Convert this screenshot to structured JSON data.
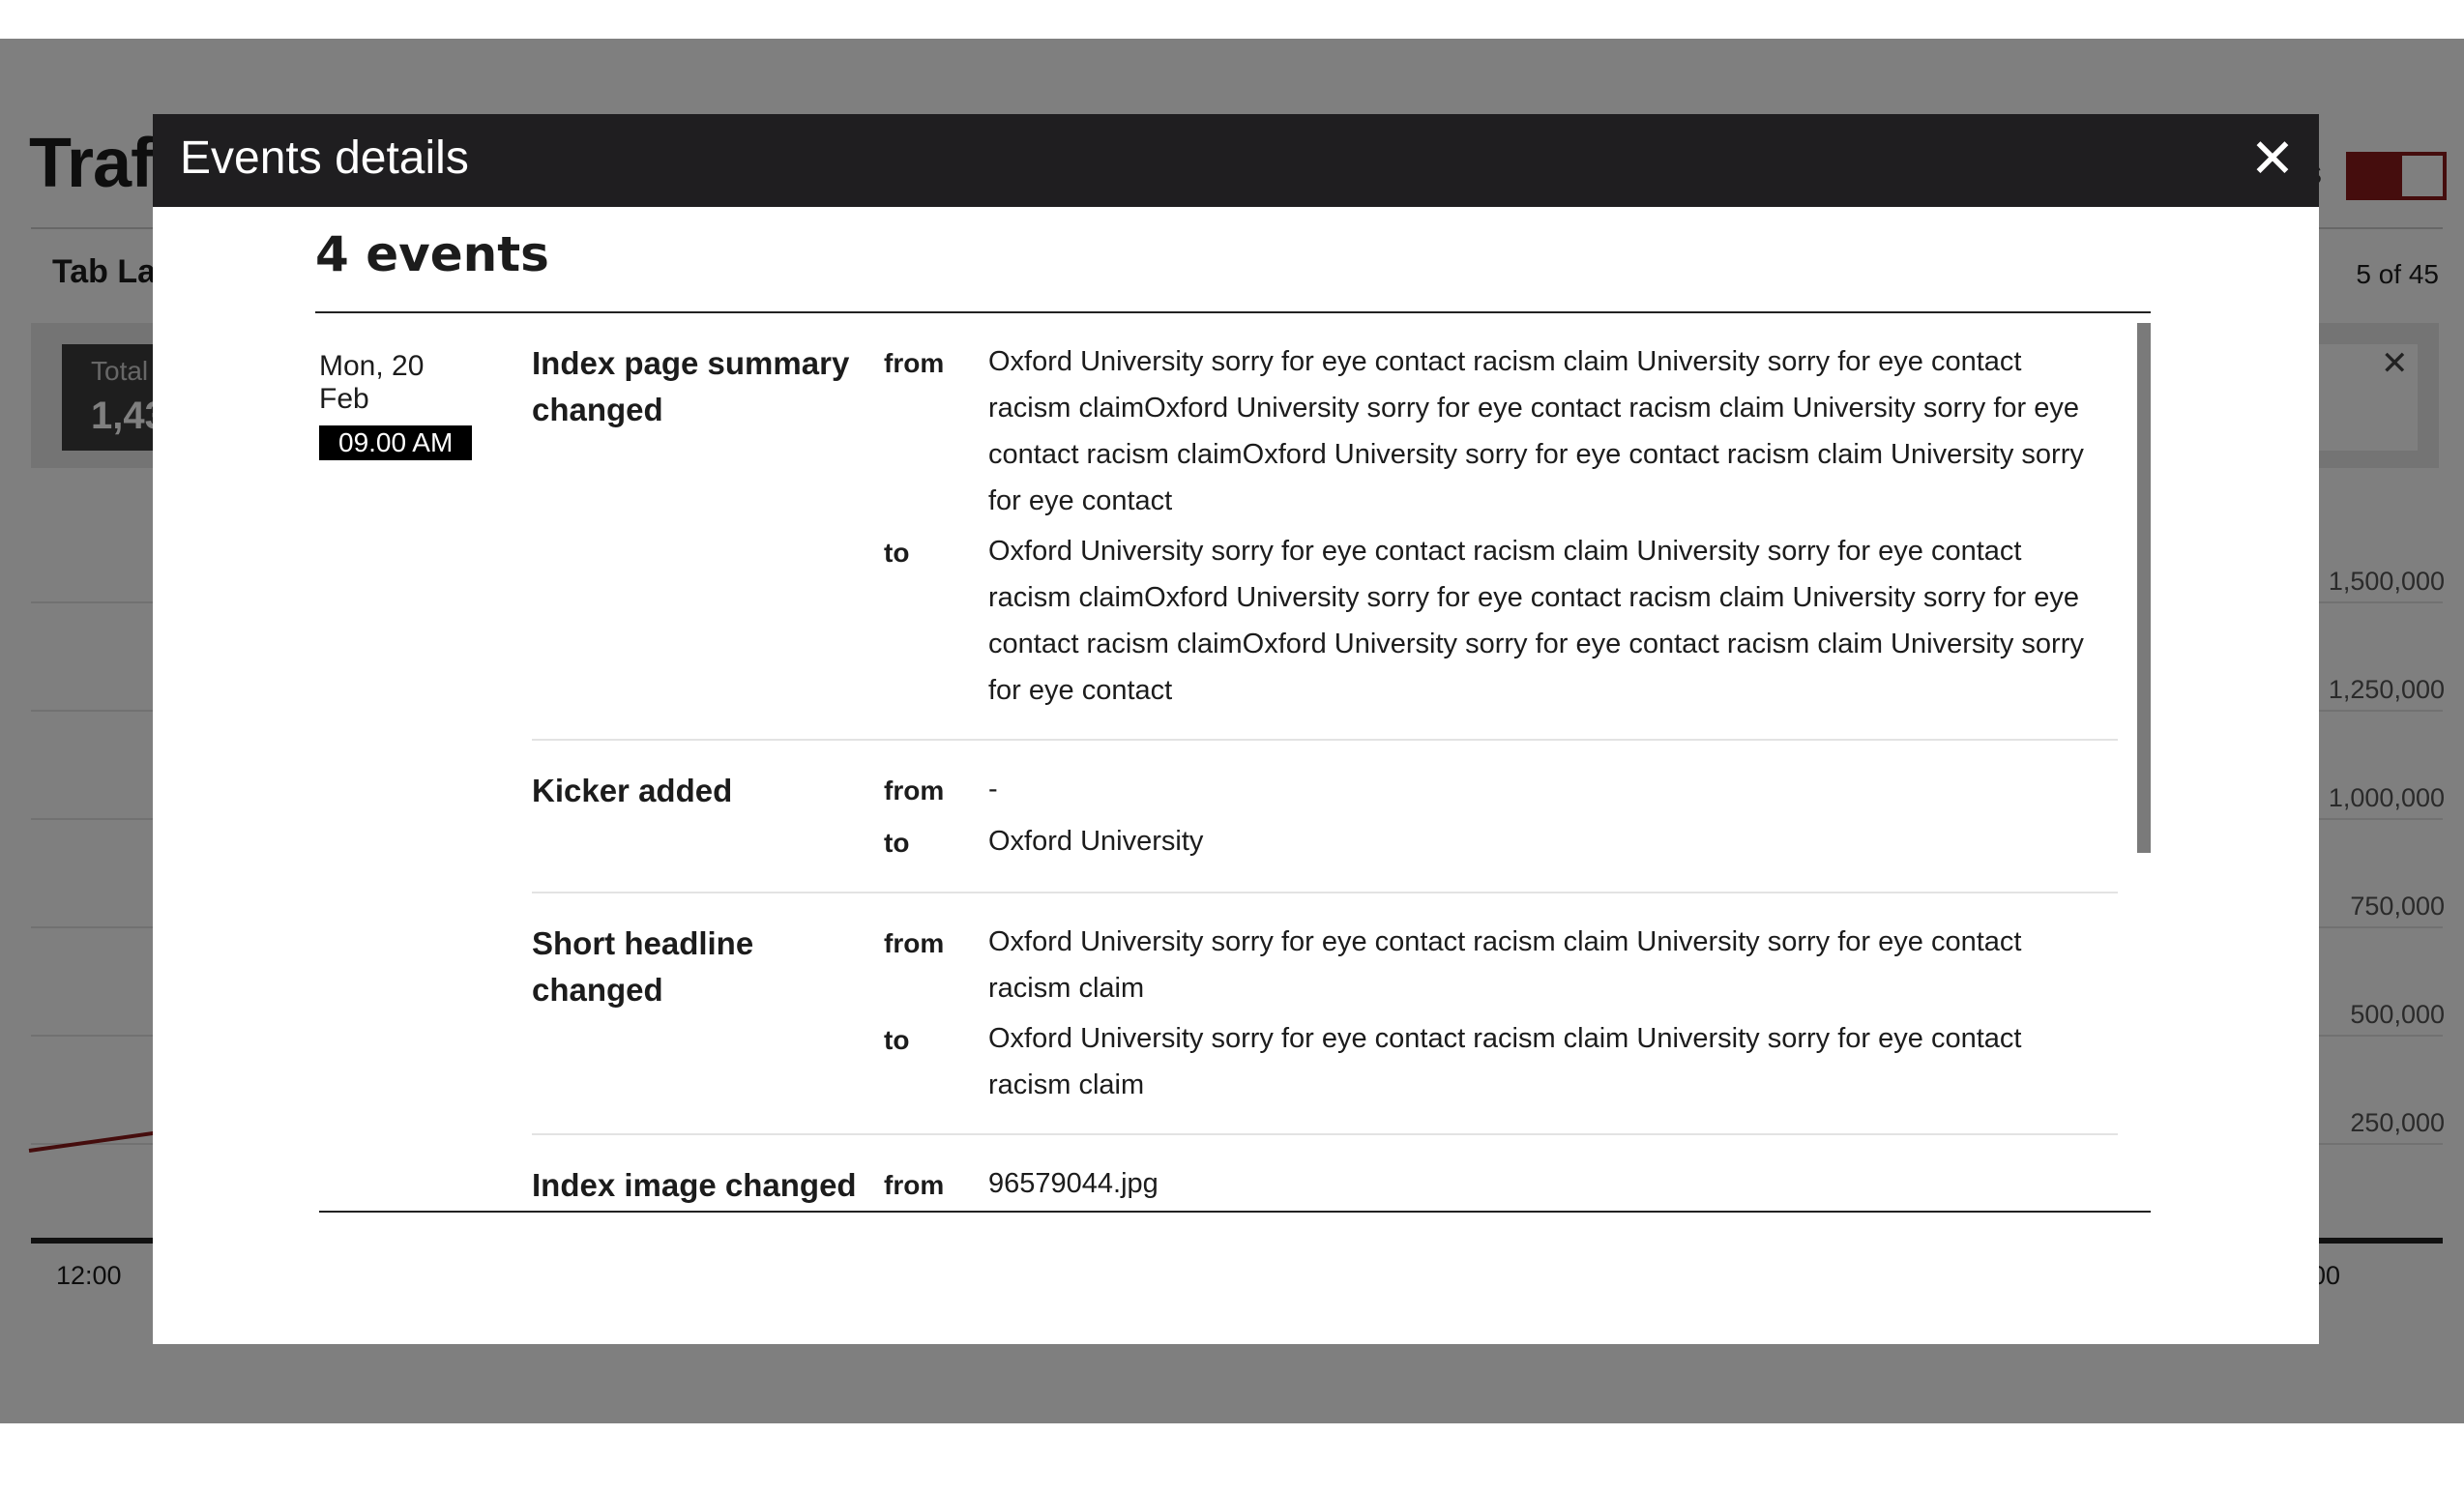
{
  "background": {
    "title": "Traff",
    "tab_label": "Tab Lal",
    "counter": "5 of 45",
    "toggle_text": "s",
    "total_label": "Total",
    "total_value": "1,43",
    "y_ticks": [
      "1,500,000",
      "1,250,000",
      "1,000,000",
      "750,000",
      "500,000",
      "250,000"
    ],
    "x_tick_left": "12:00",
    "x_tick_right": "00",
    "close_icon": "close-icon",
    "series_color": "#8b1a1a"
  },
  "modal": {
    "title": "Events details",
    "close_glyph": "✕",
    "count": "4 events",
    "date": "Mon, 20 Feb",
    "time": "09.00 AM",
    "events": [
      {
        "name": "Index page summary changed",
        "from_label": "from",
        "from": "Oxford University sorry for eye contact racism claim University sorry for eye contact racism claimOxford University sorry for eye contact racism claim University sorry for eye contact racism claimOxford University sorry for eye contact racism claim University sorry for eye contact",
        "to_label": "to",
        "to": "Oxford University sorry for eye contact racism claim University sorry for eye contact racism claimOxford University sorry for eye contact racism claim University sorry for eye contact racism claimOxford University sorry for eye contact racism claim University sorry for eye contact"
      },
      {
        "name": "Kicker added",
        "from_label": "from",
        "from": "-",
        "to_label": "to",
        "to": "Oxford University"
      },
      {
        "name": "Short headline changed",
        "from_label": "from",
        "from": "Oxford University sorry for eye contact racism claim University sorry for eye contact racism claim",
        "to_label": "to",
        "to": "Oxford University sorry for eye contact racism claim University sorry for eye contact racism claim"
      },
      {
        "name": "Index image changed",
        "from_label": "from",
        "from": "96579044.jpg",
        "to_label": "",
        "to": ""
      }
    ]
  },
  "colors": {
    "header_bg": "#1f1e20",
    "accent": "#8b1a1a",
    "overlay": "rgba(0,0,0,0.5)"
  }
}
